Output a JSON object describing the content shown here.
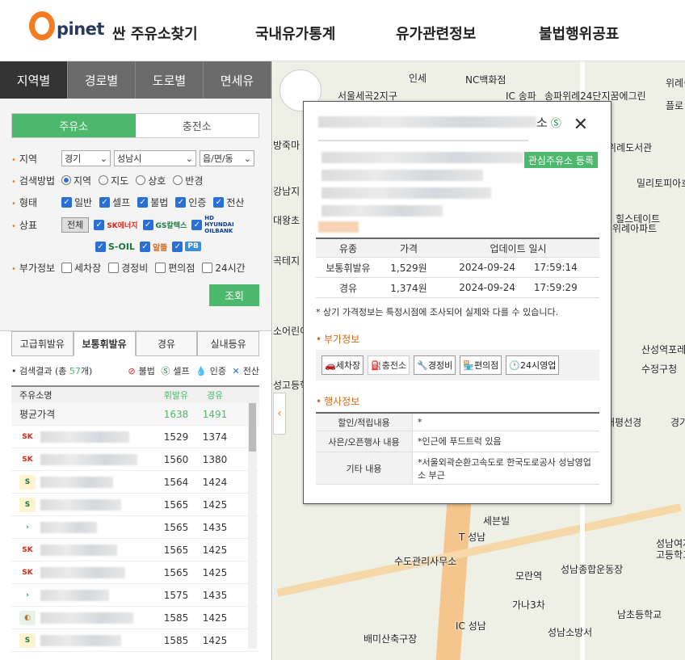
{
  "header": {
    "logo_text": "pinet",
    "nav": [
      "싼 주유소찾기",
      "국내유가통계",
      "유가관련정보",
      "불법행위공표"
    ]
  },
  "left_tabs": [
    "지역별",
    "경로별",
    "도로별",
    "면세유"
  ],
  "fuel_switch": [
    "주유소",
    "충전소"
  ],
  "filters": {
    "region_label": "지역",
    "region_values": [
      "경기",
      "성남시",
      "읍/면/동"
    ],
    "method_label": "검색방법",
    "method_options": [
      "지역",
      "지도",
      "상호",
      "반경"
    ],
    "type_label": "형태",
    "type_options": [
      "일반",
      "셀프",
      "불법",
      "인증",
      "전산"
    ],
    "brand_label": "상표",
    "brand_all": "전체",
    "brands": [
      "SK에너지",
      "GS칼텍스",
      "HD HYUNDAI OILBANK",
      "S-OIL",
      "알뜰",
      "PB"
    ],
    "extra_label": "부가정보",
    "extra_options": [
      "세차장",
      "경정비",
      "편의점",
      "24시간"
    ],
    "search_button": "조회"
  },
  "result_tabs": [
    "고급휘발유",
    "보통휘발유",
    "경유",
    "실내등유"
  ],
  "result_info": {
    "prefix": "검색결과 (총 ",
    "count": "57",
    "suffix": "개)",
    "legend": [
      "불법",
      "셀프",
      "인증",
      "전산"
    ]
  },
  "table": {
    "headers": [
      "주유소명",
      "휘발유",
      "경유"
    ],
    "avg": {
      "name": "평균가격",
      "gasoline": "1638",
      "diesel": "1491"
    },
    "rows": [
      {
        "brand": "SK",
        "gasoline": "1529",
        "diesel": "1374"
      },
      {
        "brand": "SK",
        "gasoline": "1560",
        "diesel": "1380"
      },
      {
        "brand": "S-OIL",
        "gasoline": "1564",
        "diesel": "1424"
      },
      {
        "brand": "S-OIL",
        "gasoline": "1565",
        "diesel": "1425"
      },
      {
        "brand": "HD",
        "gasoline": "1565",
        "diesel": "1435"
      },
      {
        "brand": "SK",
        "gasoline": "1565",
        "diesel": "1425"
      },
      {
        "brand": "SK",
        "gasoline": "1565",
        "diesel": "1425"
      },
      {
        "brand": "HD",
        "gasoline": "1575",
        "diesel": "1435"
      },
      {
        "brand": "알뜰",
        "gasoline": "1585",
        "diesel": "1425"
      },
      {
        "brand": "S-OIL",
        "gasoline": "1585",
        "diesel": "1425"
      }
    ]
  },
  "map_labels": [
    "인세",
    "NC백화점",
    "서울세곡2지구",
    "IC 송파",
    "송파위례24단지꿈에그린",
    "위례송",
    "플로",
    "방죽마",
    "위례도서관",
    "밀리토피아호텔",
    "강남지",
    "대왕초",
    "힐스테이트",
    "위례아파트",
    "곡테지",
    "소어린이",
    "산성역포레",
    "수정구청",
    "성고등학",
    "태평선경",
    "경기",
    "T 성남",
    "수도관리사무소",
    "모란역",
    "성남여자",
    "고등학교",
    "성남종합운동장",
    "가나3차",
    "IC 성남",
    "성남소방서",
    "남초등학교",
    "배미산축구장",
    "세븐빌"
  ],
  "popup": {
    "title_suffix": "소",
    "fav_button": "관심주유소 등록",
    "price_headers": [
      "유종",
      "가격",
      "업데이트 일시"
    ],
    "prices": [
      {
        "fuel": "보통휘발유",
        "price": "1,529원",
        "date": "2024-09-24",
        "time": "17:59:14"
      },
      {
        "fuel": "경유",
        "price": "1,374원",
        "date": "2024-09-24",
        "time": "17:59:29"
      }
    ],
    "note": "* 상기 가격정보는 특정시점에 조사되어 실제와 다를 수 있습니다.",
    "extra_title": "부가정보",
    "amenities": [
      "세차장",
      "충전소",
      "경정비",
      "편의점",
      "24시영업"
    ],
    "event_title": "행사정보",
    "events": [
      {
        "k": "할인/적립내용",
        "v": "*"
      },
      {
        "k": "사은/오픈행사 내용",
        "v": "*인근에 푸드트럭 있음"
      },
      {
        "k": "기타 내용",
        "v": "*서울외곽순환고속도로 한국도로공사 성남영업소 부근"
      }
    ]
  }
}
